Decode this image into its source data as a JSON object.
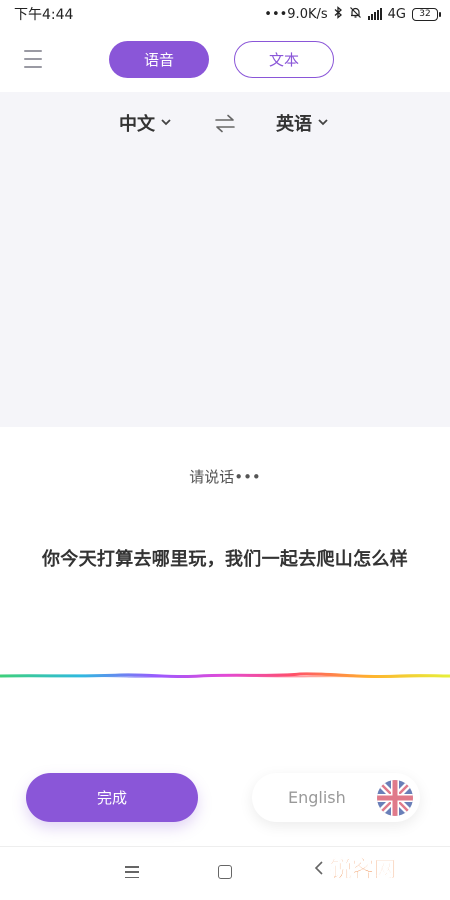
{
  "status_bar": {
    "time": "下午4:44",
    "network_speed": "•••9.0K/s",
    "network_type": "4G",
    "battery_level": "32"
  },
  "tabs": {
    "voice": "语音",
    "text": "文本",
    "active": "voice"
  },
  "languages": {
    "source": "中文",
    "target": "英语"
  },
  "prompt": "请说话•••",
  "transcript": "你今天打算去哪里玩，我们一起去爬山怎么样",
  "controls": {
    "done_label": "完成",
    "language_label": "English"
  },
  "watermark": "锐客网",
  "colors": {
    "accent": "#8a56d8",
    "panel_bg": "#f5f5f9"
  },
  "icons": {
    "menu": "hamburger-menu-icon",
    "swap": "swap-arrows-icon",
    "flag": "uk-flag-icon"
  }
}
